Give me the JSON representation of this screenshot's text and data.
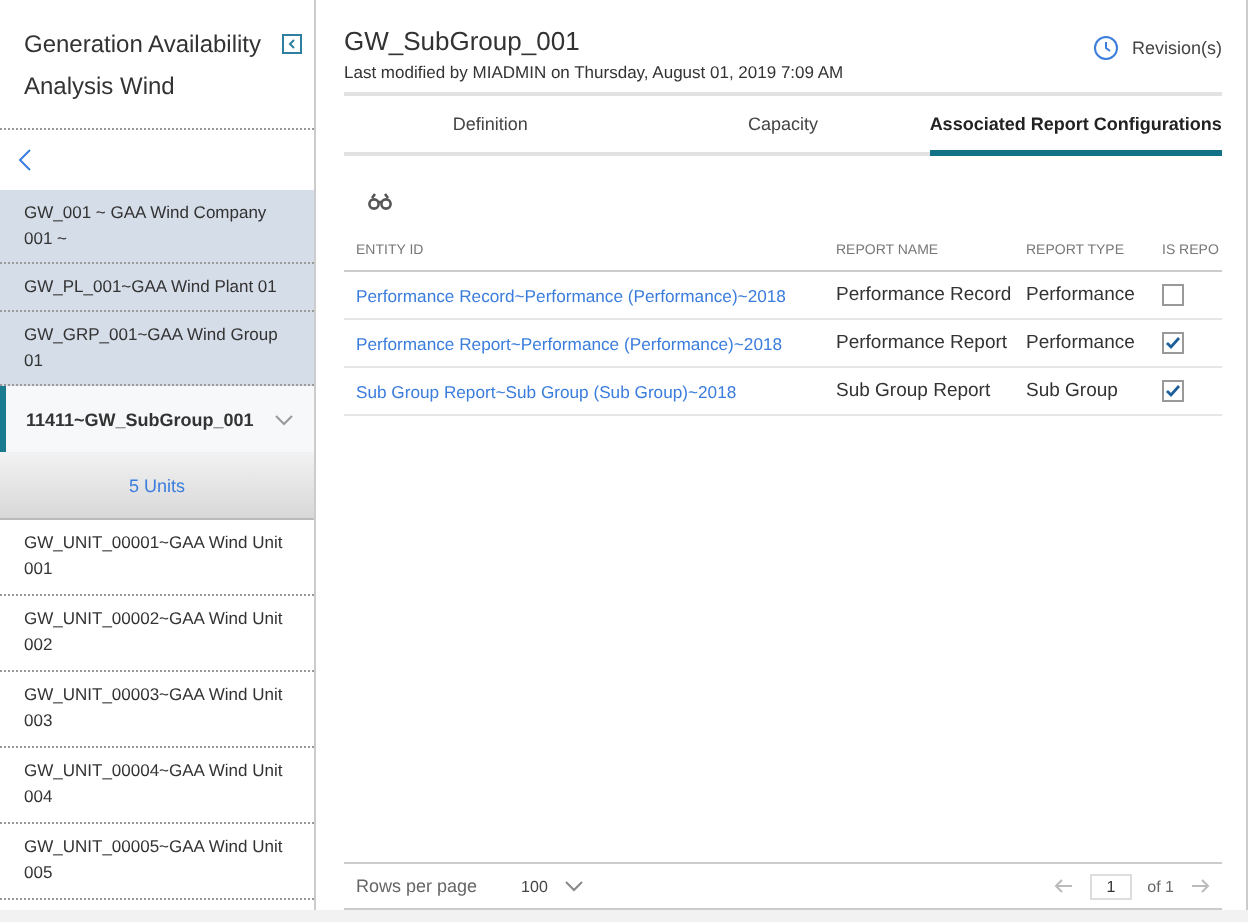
{
  "sidebar": {
    "title": "Generation Availability Analysis Wind",
    "breadcrumbs": [
      {
        "label": "GW_001 ~ GAA Wind Company 001 ~"
      },
      {
        "label": "GW_PL_001~GAA Wind Plant 01"
      },
      {
        "label": "GW_GRP_001~GAA Wind Group 01"
      }
    ],
    "current": {
      "label": "11411~GW_SubGroup_001",
      "expanded": true
    },
    "units_label": "5 Units",
    "units": [
      {
        "label": "GW_UNIT_00001~GAA Wind Unit 001"
      },
      {
        "label": "GW_UNIT_00002~GAA Wind Unit 002"
      },
      {
        "label": "GW_UNIT_00003~GAA Wind Unit 003"
      },
      {
        "label": "GW_UNIT_00004~GAA Wind Unit 004"
      },
      {
        "label": "GW_UNIT_00005~GAA Wind Unit 005"
      }
    ]
  },
  "header": {
    "title": "GW_SubGroup_001",
    "subtitle": "Last modified by MIADMIN on Thursday, August 01, 2019 7:09 AM",
    "revisions": "Revision(s)"
  },
  "tabs": [
    {
      "label": "Definition",
      "selected": false
    },
    {
      "label": "Capacity",
      "selected": false
    },
    {
      "label": "Associated Report Configurations",
      "selected": true
    }
  ],
  "table": {
    "columns": [
      "ENTITY ID",
      "REPORT NAME",
      "REPORT TYPE",
      "IS REPO"
    ],
    "rows": [
      {
        "entity_id": "Performance Record~Performance (Performance)~2018",
        "report_name": "Performance Record",
        "report_type": "Performance",
        "checked": false
      },
      {
        "entity_id": "Performance Report~Performance (Performance)~2018",
        "report_name": "Performance Report",
        "report_type": "Performance",
        "checked": true
      },
      {
        "entity_id": "Sub Group Report~Sub Group (Sub Group)~2018",
        "report_name": "Sub Group Report",
        "report_type": "Sub Group",
        "checked": true
      }
    ]
  },
  "footer": {
    "rows_per_page_label": "Rows per page",
    "rows_per_page": "100",
    "page": "1",
    "of": "of 1"
  }
}
